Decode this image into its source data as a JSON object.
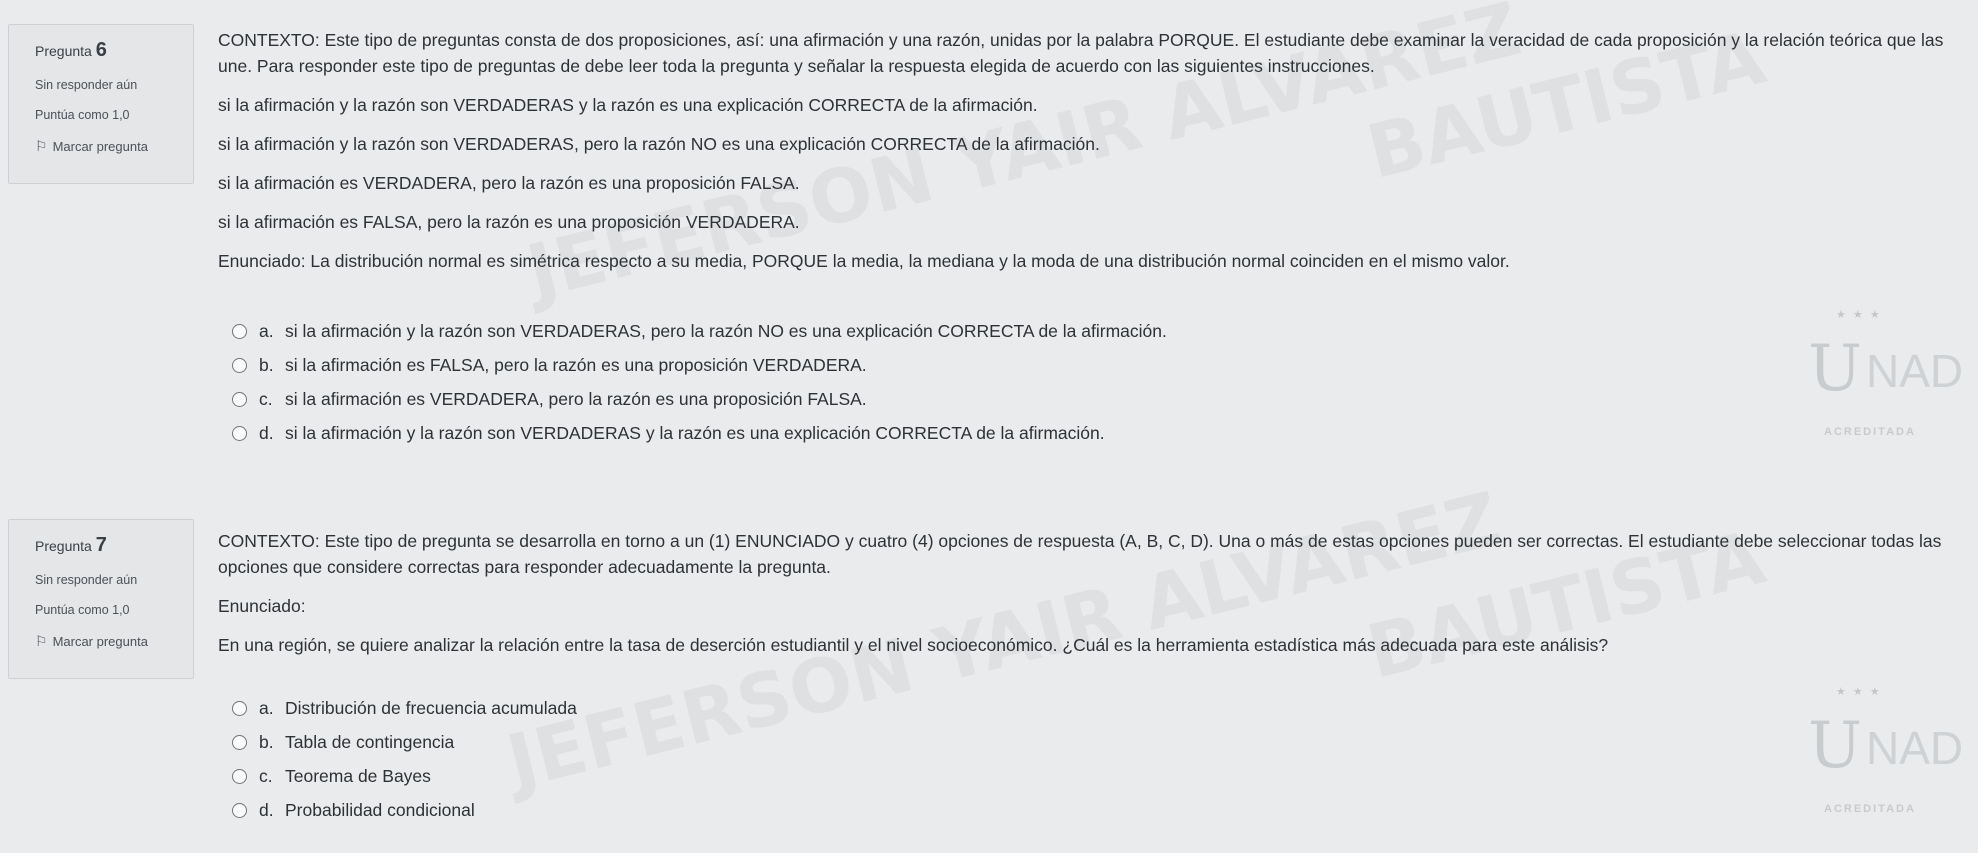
{
  "watermark": {
    "line1": "BAUTISTA",
    "line2": "JEFERSON YAIR ALVAREZ"
  },
  "questions": [
    {
      "label": "Pregunta",
      "number": "6",
      "status": "Sin responder aún",
      "score": "Puntúa como 1,0",
      "flag_label": "Marcar pregunta",
      "paragraphs": [
        "CONTEXTO: Este tipo de preguntas consta de dos proposiciones, así: una afirmación y una razón, unidas por la palabra PORQUE. El estudiante debe examinar la veracidad de cada proposición y la relación teórica que las une. Para responder este tipo de preguntas de debe leer toda la pregunta y señalar la respuesta elegida de acuerdo con las siguientes instrucciones.",
        "si la afirmación y la razón son VERDADERAS y la razón es una explicación CORRECTA de la afirmación.",
        "si la afirmación y la razón son VERDADERAS, pero la razón NO es una explicación CORRECTA de la afirmación.",
        "si la afirmación es VERDADERA, pero la razón es una proposición FALSA.",
        "si la afirmación es FALSA, pero la razón es una proposición VERDADERA.",
        "Enunciado: La distribución normal es simétrica respecto a su media, PORQUE la media, la mediana y la moda de una distribución normal coinciden en el mismo valor."
      ],
      "options": [
        {
          "letter": "a.",
          "text": "si la afirmación y la razón son VERDADERAS, pero la razón NO es una explicación CORRECTA de la afirmación."
        },
        {
          "letter": "b.",
          "text": "si la afirmación es FALSA, pero la razón es una proposición VERDADERA."
        },
        {
          "letter": "c.",
          "text": "si la afirmación es VERDADERA, pero la razón es una proposición FALSA."
        },
        {
          "letter": "d.",
          "text": "si la afirmación y la razón son VERDADERAS y la razón es una explicación CORRECTA de la afirmación."
        }
      ]
    },
    {
      "label": "Pregunta",
      "number": "7",
      "status": "Sin responder aún",
      "score": "Puntúa como 1,0",
      "flag_label": "Marcar pregunta",
      "paragraphs": [
        "CONTEXTO: Este tipo de pregunta se desarrolla en torno a un (1) ENUNCIADO y cuatro (4) opciones de respuesta (A, B, C, D). Una o más de estas opciones pueden ser correctas. El estudiante debe seleccionar todas las opciones que considere correctas para responder adecuadamente la pregunta.",
        "Enunciado:",
        "En una región, se quiere analizar la relación entre la tasa de deserción estudiantil y el nivel socioeconómico. ¿Cuál es la herramienta estadística más adecuada para este análisis?"
      ],
      "options": [
        {
          "letter": "a.",
          "text": "Distribución de frecuencia acumulada"
        },
        {
          "letter": "b.",
          "text": "Tabla de contingencia"
        },
        {
          "letter": "c.",
          "text": "Teorema de Bayes"
        },
        {
          "letter": "d.",
          "text": "Probabilidad condicional"
        }
      ]
    }
  ],
  "logo": {
    "mark": "U",
    "text": "NAD",
    "stars": "★ ★ ★",
    "badge": "ACREDITADA"
  },
  "colors": {
    "background": "#e9ebec",
    "info_box": "#e4e6e8",
    "text": "#2e3236"
  },
  "icons": {
    "flag": "flag-icon",
    "radio": "radio-button"
  }
}
